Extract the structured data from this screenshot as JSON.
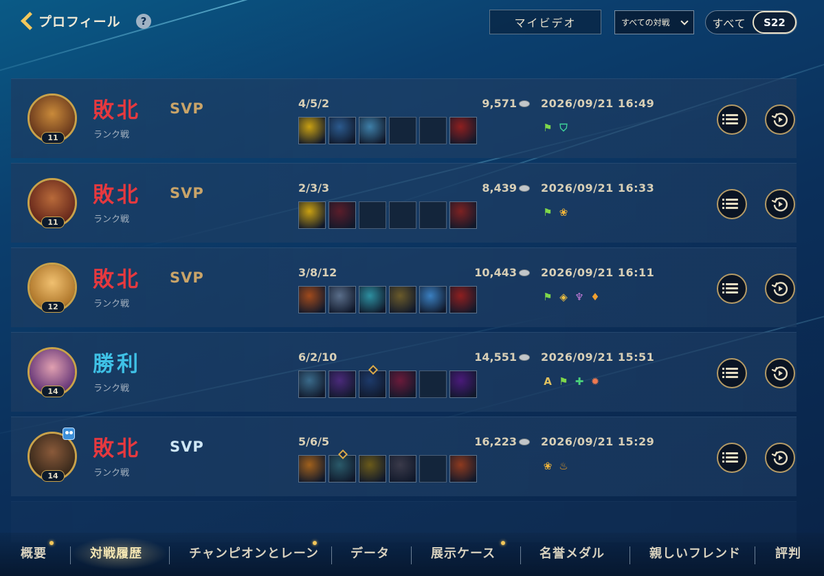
{
  "header": {
    "back_label": "プロフィール",
    "help_icon": "?",
    "video_button": "マイビデオ",
    "filter_select": "すべての対戦",
    "season_all": "すべて",
    "season_current": "S22"
  },
  "matches": [
    {
      "result": "敗北",
      "result_type": "loss",
      "mode": "ランク戦",
      "svp": "SVP",
      "svp_style": "gold",
      "level": "11",
      "kda": "4/5/2",
      "gold": "9,571",
      "date": "2026/09/21",
      "time": "16:49",
      "avatar_colors": [
        "#6b3a1d",
        "#c98a3a"
      ],
      "items": [
        "#c9a012",
        "#2b5a8e",
        "#3e7fa8",
        "empty",
        "empty",
        "#8e1f1f"
      ],
      "badges": [
        "flag-badge",
        "shield-badge"
      ]
    },
    {
      "result": "敗北",
      "result_type": "loss",
      "mode": "ランク戦",
      "svp": "SVP",
      "svp_style": "gold",
      "level": "11",
      "kda": "2/3/3",
      "gold": "8,439",
      "date": "2026/09/21",
      "time": "16:33",
      "avatar_colors": [
        "#6a2a1c",
        "#b86a3a"
      ],
      "items": [
        "#c9a012",
        "#5a1d2a",
        "empty",
        "empty",
        "empty",
        "#7d2222"
      ],
      "badges": [
        "flag-badge",
        "lotus-badge"
      ]
    },
    {
      "result": "敗北",
      "result_type": "loss",
      "mode": "ランク戦",
      "svp": "SVP",
      "svp_style": "gold",
      "level": "12",
      "kda": "3/8/12",
      "gold": "10,443",
      "date": "2026/09/21",
      "time": "16:11",
      "avatar_colors": [
        "#b0782c",
        "#f0c070"
      ],
      "items": [
        "#a04a1c",
        "#5a6e8a",
        "#2d8fa0",
        "#6a5a2a",
        "#3a7fc0",
        "#8e1f1f"
      ],
      "badges": [
        "flag-badge",
        "tactic-badge",
        "wing-badge",
        "flame-badge"
      ]
    },
    {
      "result": "勝利",
      "result_type": "win",
      "mode": "ランク戦",
      "svp": "",
      "svp_style": "none",
      "level": "14",
      "kda": "6/2/10",
      "gold": "14,551",
      "date": "2026/09/21",
      "time": "15:51",
      "avatar_colors": [
        "#6a3a7a",
        "#e0a0b0"
      ],
      "items": [
        "#3a6a8a",
        "#4a2a7a",
        "#1d3a6a",
        "#6a1a3a",
        "empty",
        "#4a1a7a"
      ],
      "badges": [
        "a-grade-badge",
        "flag-badge",
        "heal-badge",
        "dragon-badge"
      ]
    },
    {
      "result": "敗北",
      "result_type": "loss",
      "mode": "ランク戦",
      "svp": "SVP",
      "svp_style": "silver",
      "level": "14",
      "kda": "5/6/5",
      "gold": "16,223",
      "date": "2026/09/21",
      "time": "15:29",
      "avatar_colors": [
        "#3a2a1c",
        "#8a5a3a"
      ],
      "items": [
        "#a0601c",
        "#2a5a6a",
        "#6a5a1a",
        "#3a3a4a",
        "empty",
        "#8e3a1f"
      ],
      "badges": [
        "lotus-badge",
        "fire-badge"
      ]
    }
  ],
  "nav": {
    "overview": "概要",
    "history": "対戦履歴",
    "champion_lane": "チャンピオンとレーン",
    "data": "データ",
    "showcase": "展示ケース",
    "honor": "名誉メダル",
    "friends": "親しいフレンド",
    "reputation": "評判"
  }
}
